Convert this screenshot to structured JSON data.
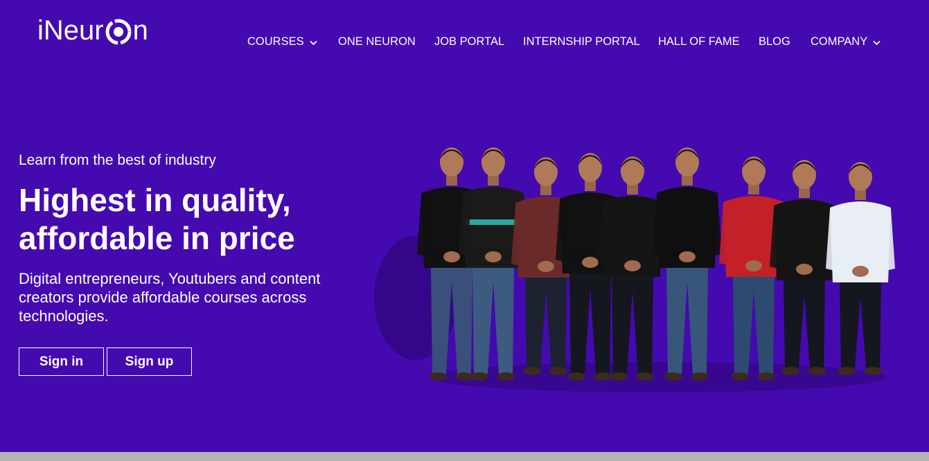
{
  "brand": {
    "logo_prefix": "iNeur",
    "logo_suffix": "n"
  },
  "nav": {
    "items": [
      {
        "label": "COURSES",
        "has_dropdown": true
      },
      {
        "label": "ONE NEURON",
        "has_dropdown": false
      },
      {
        "label": "JOB PORTAL",
        "has_dropdown": false
      },
      {
        "label": "INTERNSHIP PORTAL",
        "has_dropdown": false
      },
      {
        "label": "HALL OF FAME",
        "has_dropdown": false
      },
      {
        "label": "BLOG",
        "has_dropdown": false
      },
      {
        "label": "COMPANY",
        "has_dropdown": true
      }
    ]
  },
  "hero": {
    "eyebrow": "Learn from the best of industry",
    "headline_line1": "Highest in quality,",
    "headline_line2": "affordable in price",
    "subtext": "Digital entrepreneurs, Youtubers and content creators provide affordable courses across technologies.",
    "signin_label": "Sign in",
    "signup_label": "Sign up"
  },
  "colors": {
    "background": "#4509b0",
    "text": "#ffffff",
    "footer_strip": "#b4b4b8"
  },
  "icons": {
    "logo_o": "ring-logo-icon",
    "dropdown": "chevron-down-icon"
  }
}
